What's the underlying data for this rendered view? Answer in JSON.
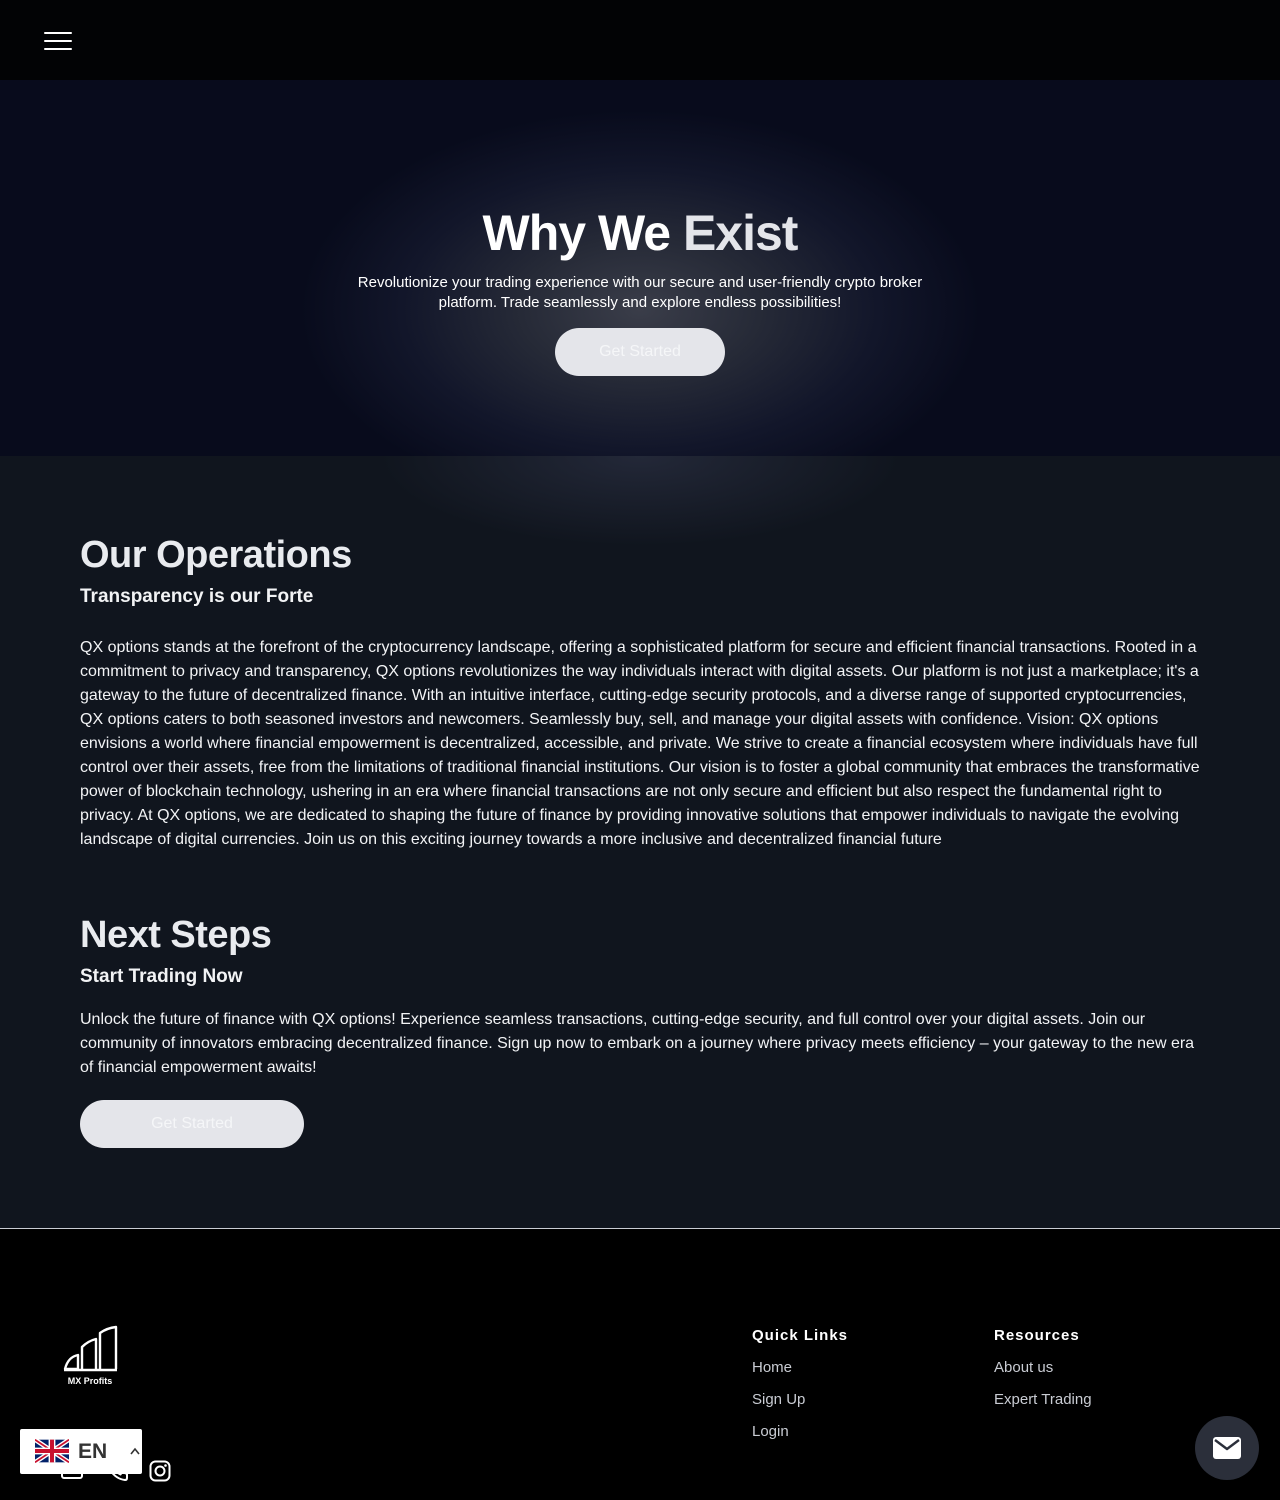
{
  "nav": {
    "menu_icon": "hamburger-menu-icon"
  },
  "hero": {
    "title_main": "Why We ",
    "title_accent": "Exist",
    "subtitle_line1": "Revolutionize your trading experience with our secure and user-friendly crypto broker",
    "subtitle_line2": "platform. Trade seamlessly and explore endless possibilities!",
    "button_label": "Get Started"
  },
  "operations": {
    "heading": "Our Operations",
    "subheading": "Transparency is our Forte",
    "body": "QX options stands at the forefront of the cryptocurrency landscape, offering a sophisticated platform for secure and efficient financial transactions. Rooted in a commitment to privacy and transparency, QX options revolutionizes the way individuals interact with digital assets. Our platform is not just a marketplace; it's a gateway to the future of decentralized finance. With an intuitive interface, cutting-edge security protocols, and a diverse range of supported cryptocurrencies, QX options caters to both seasoned investors and newcomers. Seamlessly buy, sell, and manage your digital assets with confidence. Vision: QX options envisions a world where financial empowerment is decentralized, accessible, and private. We strive to create a financial ecosystem where individuals have full control over their assets, free from the limitations of traditional financial institutions. Our vision is to foster a global community that embraces the transformative power of blockchain technology, ushering in an era where financial transactions are not only secure and efficient but also respect the fundamental right to privacy. At QX options, we are dedicated to shaping the future of finance by providing innovative solutions that empower individuals to navigate the evolving landscape of digital currencies. Join us on this exciting journey towards a more inclusive and decentralized financial future"
  },
  "next_steps": {
    "heading": "Next Steps",
    "subheading": "Start Trading Now",
    "body": "Unlock the future of finance with QX options! Experience seamless transactions, cutting-edge security, and full control over your digital assets. Join our community of innovators embracing decentralized finance. Sign up now to embark on a journey where privacy meets efficiency – your gateway to the new era of financial empowerment awaits!",
    "button_label": "Get Started"
  },
  "footer": {
    "logo_text": "MX Profits",
    "quick_links": {
      "title": "Quick Links",
      "items": [
        "Home",
        "Sign Up",
        "Login"
      ]
    },
    "resources": {
      "title": "Resources",
      "items": [
        "About us",
        "Expert Trading"
      ]
    },
    "social_icons": [
      "email-icon",
      "phone-icon",
      "instagram-icon"
    ]
  },
  "language": {
    "code": "EN",
    "flag": "uk-flag-icon"
  },
  "chat": {
    "icon": "mail-icon"
  },
  "colors": {
    "button_bg": "#e4e5ea",
    "hero_bg": "#080b1c",
    "content_bg": "#0e131c",
    "footer_bg": "#000000"
  }
}
